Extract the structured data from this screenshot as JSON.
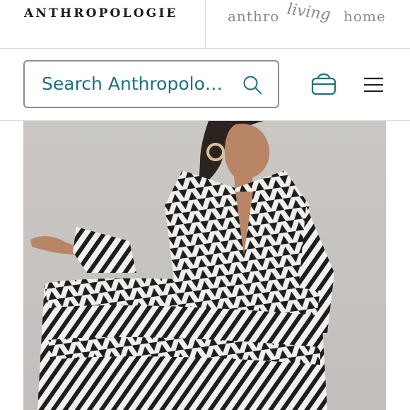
{
  "top_bar": {
    "brand": "ANTHROPOLOGIE",
    "living_home": {
      "part1": "anthro",
      "part2": "living",
      "part3": "home"
    }
  },
  "header": {
    "search": {
      "placeholder": "Search Anthropologie"
    },
    "icons": {
      "bag": "shopping-bag-icon",
      "menu": "hamburger-menu-icon",
      "search": "search-icon"
    }
  },
  "colors": {
    "accent": "#1f6f7d",
    "border": "#8d8d8d"
  }
}
